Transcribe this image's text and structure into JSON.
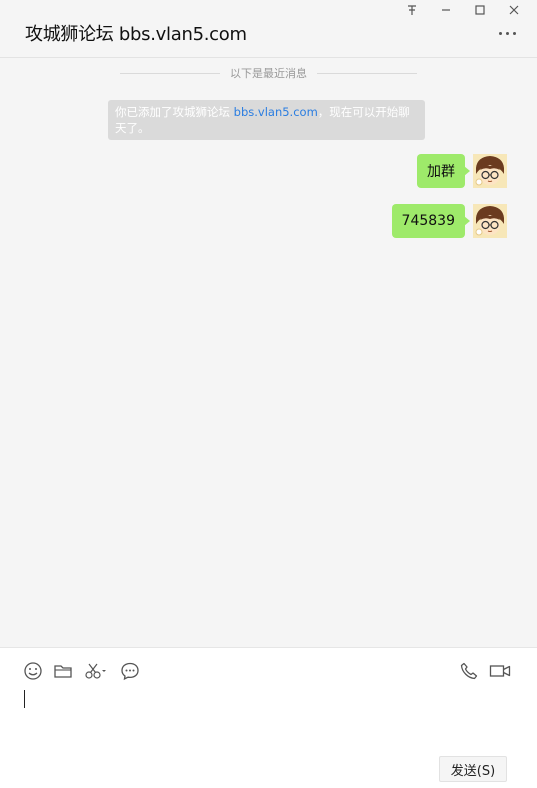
{
  "window": {
    "title": "攻城狮论坛 bbs.vlan5.com",
    "controls": {
      "pin": "〒",
      "minimize": "−",
      "maximize": "☐",
      "close": "✕"
    }
  },
  "chat": {
    "divider_text": "以下是最近消息",
    "system_message": {
      "prefix": "你已添加了攻城狮论坛 ",
      "link": "bbs.vlan5.com",
      "suffix_line1": "，现在可以开始聊",
      "suffix_line2": "天了。"
    },
    "messages": [
      {
        "text": "加群",
        "sender": "me"
      },
      {
        "text": "745839",
        "sender": "me"
      }
    ]
  },
  "composer": {
    "icons": [
      "emoji-icon",
      "folder-icon",
      "scissors-icon",
      "chat-history-icon",
      "phone-icon",
      "video-icon"
    ],
    "send_label": "发送(S)"
  },
  "colors": {
    "bubble": "#9eea6a",
    "link": "#2a7de1",
    "background": "#f5f5f5"
  }
}
